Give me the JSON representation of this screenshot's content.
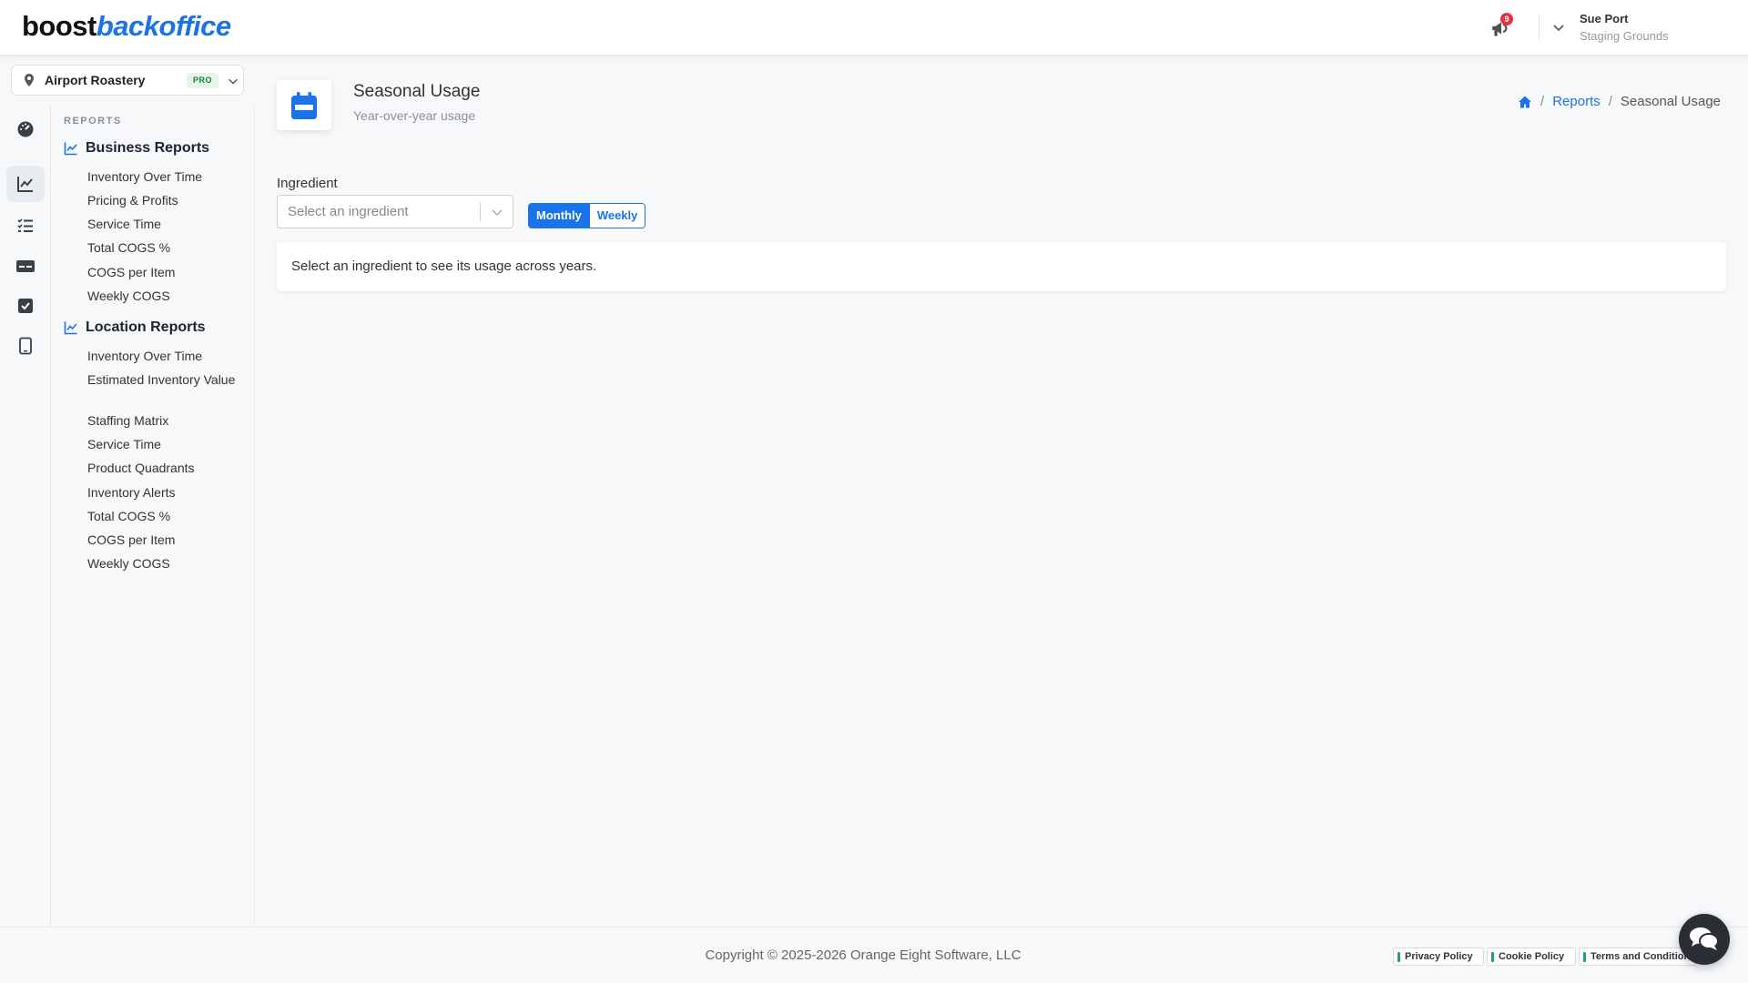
{
  "header": {
    "logo_part1": "boost",
    "logo_part2": "backoffice",
    "notification_count": "9",
    "user_name": "Sue Port",
    "user_org": "Staging Grounds"
  },
  "location": {
    "name": "Airport Roastery",
    "badge": "PRO"
  },
  "sidebar": {
    "section_label": "REPORTS",
    "business_title": "Business Reports",
    "business_items": [
      "Inventory Over Time",
      "Pricing & Profits",
      "Service Time",
      "Total COGS %",
      "COGS per Item",
      "Weekly COGS"
    ],
    "location_title": "Location Reports",
    "location_items": [
      "Inventory Over Time",
      "Estimated Inventory Value",
      "Staffing Matrix",
      "Service Time",
      "Product Quadrants",
      "Inventory Alerts",
      "Total COGS %",
      "COGS per Item",
      "Weekly COGS"
    ]
  },
  "page": {
    "title": "Seasonal Usage",
    "subtitle": "Year-over-year usage"
  },
  "breadcrumb": {
    "reports": "Reports",
    "current": "Seasonal Usage"
  },
  "form": {
    "ingredient_label": "Ingredient",
    "ingredient_placeholder": "Select an ingredient",
    "monthly_label": "Monthly",
    "weekly_label": "Weekly"
  },
  "empty_state": {
    "message": "Select an ingredient to see its usage across years."
  },
  "footer": {
    "copyright": "Copyright © 2025-2026 Orange Eight Software, LLC",
    "privacy": "Privacy Policy",
    "cookie": "Cookie Policy",
    "terms": "Terms and Conditions"
  },
  "colors": {
    "accent": "#1a73e8",
    "badge_red": "#dc3545",
    "pro_green": "#1e7e34"
  }
}
